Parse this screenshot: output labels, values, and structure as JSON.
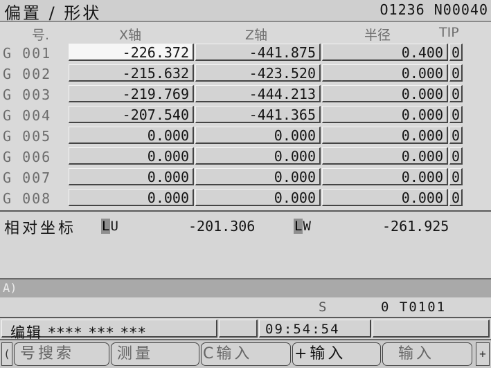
{
  "header": {
    "title": "偏置 / 形状",
    "program": "O1236 N00040"
  },
  "table": {
    "columns": {
      "no": "号.",
      "x": "X轴",
      "z": "Z轴",
      "r": "半径",
      "tip": "TIP"
    },
    "rows": [
      {
        "g": "G",
        "no": "001",
        "x": "-226.372",
        "z": "-441.875",
        "r": "0.400",
        "t": "0"
      },
      {
        "g": "G",
        "no": "002",
        "x": "-215.632",
        "z": "-423.520",
        "r": "0.000",
        "t": "0"
      },
      {
        "g": "G",
        "no": "003",
        "x": "-219.769",
        "z": "-444.213",
        "r": "0.000",
        "t": "0"
      },
      {
        "g": "G",
        "no": "004",
        "x": "-207.540",
        "z": "-441.365",
        "r": "0.000",
        "t": "0"
      },
      {
        "g": "G",
        "no": "005",
        "x": "0.000",
        "z": "0.000",
        "r": "0.000",
        "t": "0"
      },
      {
        "g": "G",
        "no": "006",
        "x": "0.000",
        "z": "0.000",
        "r": "0.000",
        "t": "0"
      },
      {
        "g": "G",
        "no": "007",
        "x": "0.000",
        "z": "0.000",
        "r": "0.000",
        "t": "0"
      },
      {
        "g": "G",
        "no": "008",
        "x": "0.000",
        "z": "0.000",
        "r": "0.000",
        "t": "0"
      }
    ]
  },
  "relative": {
    "label": "相对坐标",
    "u_first": "L",
    "u_rest": "U",
    "u_value": "-201.306",
    "w_first": "L",
    "w_rest": "W",
    "w_value": "-261.925"
  },
  "input": {
    "prompt": "A)"
  },
  "status": {
    "spindle": "S",
    "tool": "0 T0101"
  },
  "mode": {
    "text": "编辑  ****  ***  ***",
    "clock": "09:54:54"
  },
  "softkeys": {
    "left": "(",
    "right": "+",
    "keys": [
      "号搜索",
      "测量",
      "C输入",
      "+输入",
      "输入"
    ]
  },
  "colors": {
    "background": "#d6d6d6",
    "highlight": "#8f8f8f",
    "selected_cell": "#f6f6f6"
  }
}
